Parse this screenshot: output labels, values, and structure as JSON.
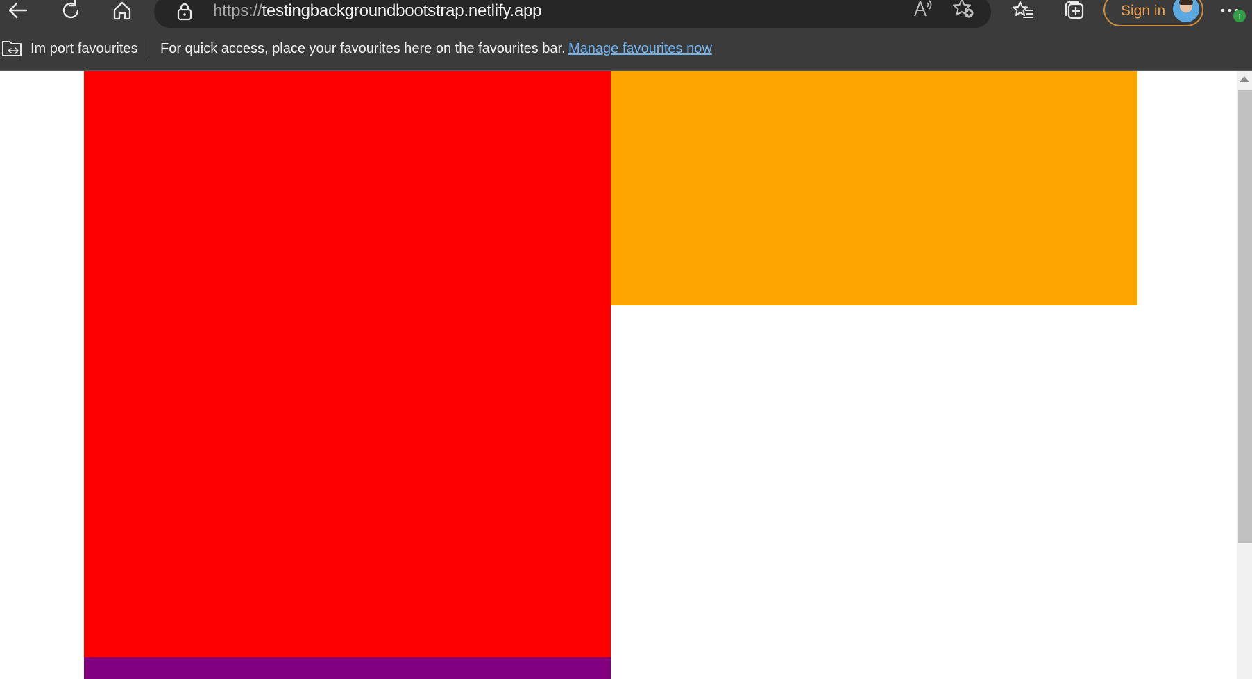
{
  "browser": {
    "url_scheme": "https://",
    "url_host": "testingbackgroundbootstrap.netlify.app",
    "sign_in_label": "Sign in",
    "colors": {
      "chrome_bg": "#3b3b3b",
      "address_bar_bg": "#262626",
      "sign_in_accent": "#e8a050",
      "link": "#6fb4f0"
    },
    "toolbar_icons": [
      "back-icon",
      "refresh-icon",
      "home-icon",
      "lock-icon",
      "read-aloud-icon",
      "add-favourite-icon",
      "favourites-icon",
      "collections-icon",
      "more-icon",
      "update-badge-icon"
    ]
  },
  "favourites_bar": {
    "import_label": "Im port favourites",
    "hint_text": "For quick access, place your favourites here on the favourites bar.",
    "manage_link": "Manage favourites now"
  },
  "page": {
    "boxes": [
      {
        "name": "red-box",
        "color": "#ff0000"
      },
      {
        "name": "orange-box",
        "color": "#ffa500"
      },
      {
        "name": "purple-box",
        "color": "#800080"
      }
    ]
  }
}
